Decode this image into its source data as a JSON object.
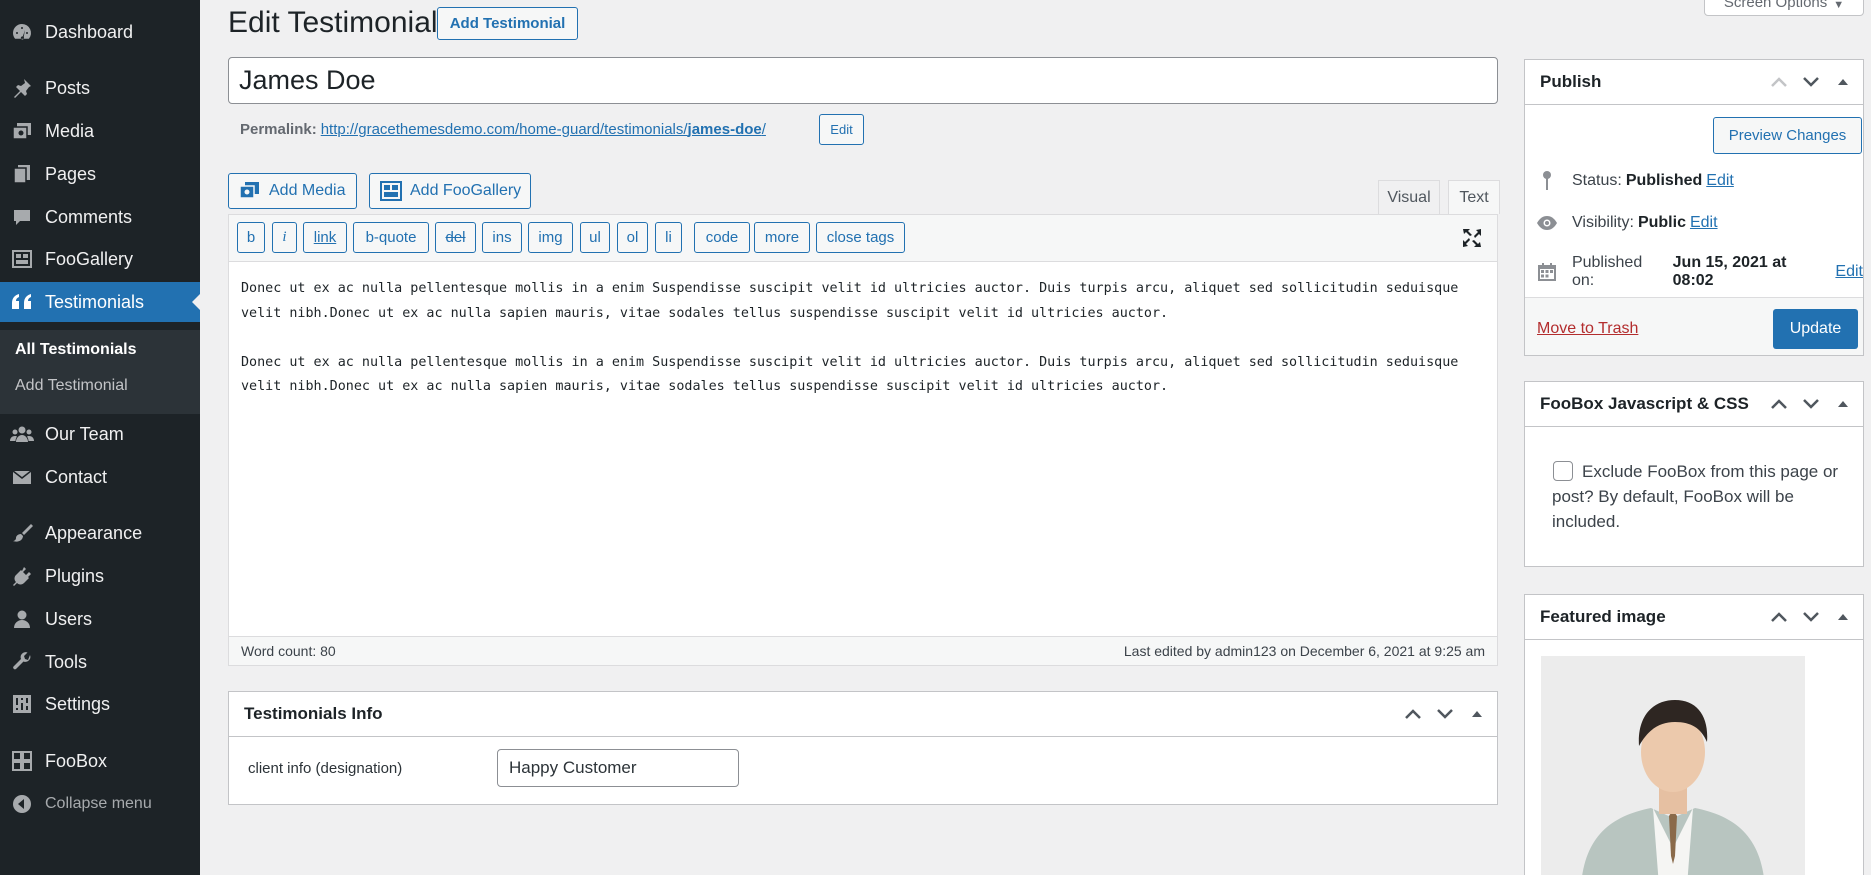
{
  "sidebar": {
    "items": [
      {
        "label": "Dashboard",
        "icon": "dashboard-icon"
      },
      {
        "label": "Posts",
        "icon": "pin-icon"
      },
      {
        "label": "Media",
        "icon": "media-icon"
      },
      {
        "label": "Pages",
        "icon": "pages-icon"
      },
      {
        "label": "Comments",
        "icon": "comment-icon"
      },
      {
        "label": "FooGallery",
        "icon": "gallery-icon"
      },
      {
        "label": "Testimonials",
        "icon": "quote-icon"
      },
      {
        "label": "Our Team",
        "icon": "team-icon"
      },
      {
        "label": "Contact",
        "icon": "mail-icon"
      },
      {
        "label": "Appearance",
        "icon": "brush-icon"
      },
      {
        "label": "Plugins",
        "icon": "plug-icon"
      },
      {
        "label": "Users",
        "icon": "user-icon"
      },
      {
        "label": "Tools",
        "icon": "wrench-icon"
      },
      {
        "label": "Settings",
        "icon": "settings-icon"
      },
      {
        "label": "FooBox",
        "icon": "grid-icon"
      }
    ],
    "submenu": [
      "All Testimonials",
      "Add Testimonial"
    ],
    "collapse_label": "Collapse menu"
  },
  "header": {
    "screen_options": "Screen Options",
    "title": "Edit Testimonial",
    "add_new_label": "Add Testimonial"
  },
  "post": {
    "title": "James Doe",
    "permalink_label": "Permalink:",
    "permalink_base": "http://gracethemesdemo.com/home-guard/testimonials/",
    "permalink_slug": "james-doe",
    "permalink_end": "/",
    "permalink_edit": "Edit"
  },
  "editor": {
    "add_media": "Add Media",
    "add_foogallery": "Add FooGallery",
    "tab_visual": "Visual",
    "tab_text": "Text",
    "quicktags": [
      "b",
      "i",
      "link",
      "b-quote",
      "del",
      "ins",
      "img",
      "ul",
      "ol",
      "li",
      "code",
      "more",
      "close tags"
    ],
    "paragraphs": [
      "Donec ut ex ac nulla pellentesque mollis in a enim Suspendisse suscipit velit id ultricies auctor. Duis turpis arcu, aliquet sed sollicitudin seduisque velit nibh.Donec ut ex ac nulla sapien mauris, vitae sodales tellus suspendisse suscipit velit id ultricies auctor.",
      "Donec ut ex ac nulla pellentesque mollis in a enim Suspendisse suscipit velit id ultricies auctor. Duis turpis arcu, aliquet sed sollicitudin seduisque velit nibh.Donec ut ex ac nulla sapien mauris, vitae sodales tellus suspendisse suscipit velit id ultricies auctor."
    ],
    "word_count": "Word count: 80",
    "last_edited": "Last edited by admin123 on December 6, 2021 at 9:25 am"
  },
  "testimonials_info": {
    "title": "Testimonials Info",
    "field_label": "client info (designation)",
    "field_value": "Happy Customer"
  },
  "publish": {
    "title": "Publish",
    "preview_label": "Preview Changes",
    "status_label": "Status:",
    "status_value": "Published",
    "visibility_label": "Visibility:",
    "visibility_value": "Public",
    "published_label": "Published on:",
    "published_value": "Jun 15, 2021 at 08:02",
    "edit_label": "Edit",
    "trash_label": "Move to Trash",
    "update_label": "Update"
  },
  "foobox": {
    "title": "FooBox Javascript & CSS",
    "checkbox_label": "Exclude FooBox from this page or post? By default, FooBox will be included."
  },
  "featured": {
    "title": "Featured image"
  },
  "colors": {
    "sidebar_bg": "#1d2327",
    "accent": "#2271b1",
    "trash": "#b32d2e"
  }
}
